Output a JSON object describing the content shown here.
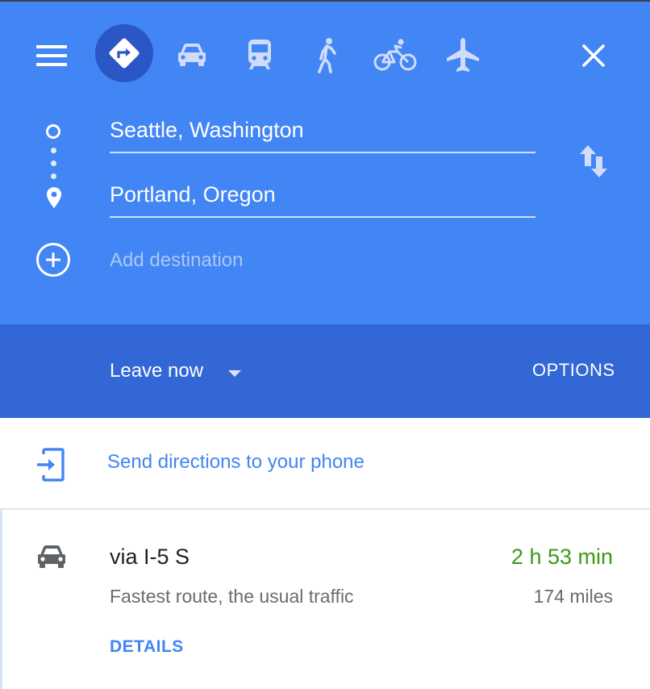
{
  "travel_modes": [
    {
      "name": "best",
      "icon": "directions-icon",
      "active": true
    },
    {
      "name": "driving",
      "icon": "car-icon",
      "active": false
    },
    {
      "name": "transit",
      "icon": "train-icon",
      "active": false
    },
    {
      "name": "walking",
      "icon": "walking-icon",
      "active": false
    },
    {
      "name": "cycling",
      "icon": "bicycle-icon",
      "active": false
    },
    {
      "name": "flights",
      "icon": "airplane-icon",
      "active": false
    }
  ],
  "route_inputs": {
    "origin": "Seattle, Washington",
    "destination": "Portland, Oregon",
    "add_destination_placeholder": "Add destination"
  },
  "departure": {
    "selected": "Leave now",
    "options_label": "OPTIONS"
  },
  "send_to_phone": {
    "label": "Send directions to your phone"
  },
  "routes": [
    {
      "title": "via I-5 S",
      "subtitle": "Fastest route, the usual traffic",
      "duration": "2 h 53 min",
      "distance": "174 miles",
      "details_label": "DETAILS"
    }
  ],
  "colors": {
    "header": "#4285f4",
    "header_dark": "#3367d6",
    "active_mode": "#2a56c6",
    "link": "#4285f4",
    "duration_green": "#3d9a15"
  }
}
